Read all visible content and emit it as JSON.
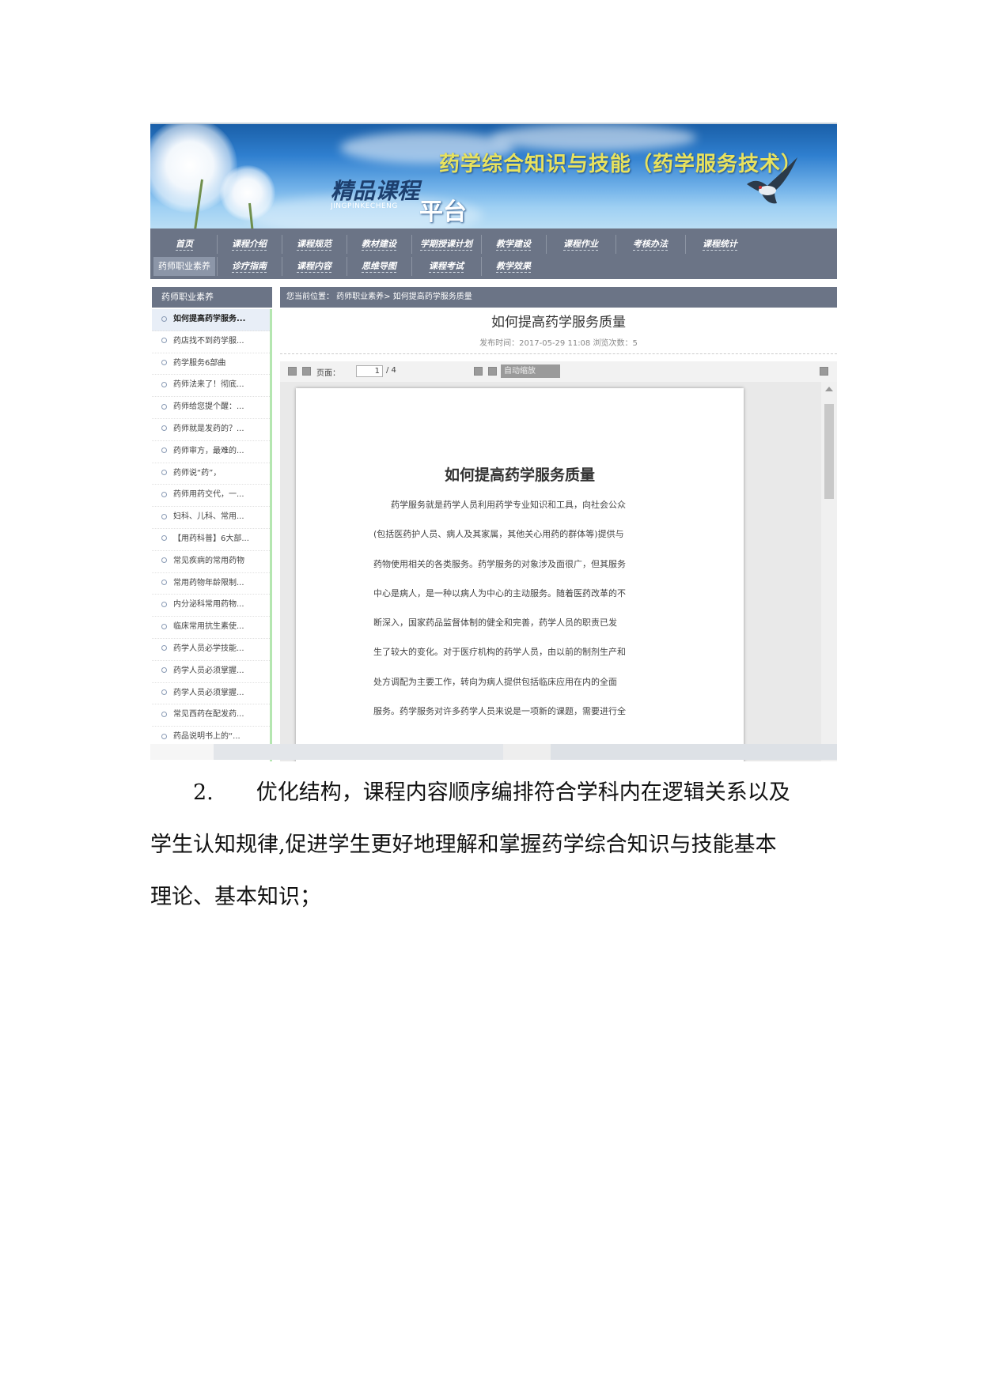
{
  "banner": {
    "course_title": "药学综合知识与技能（药学服务技术）",
    "platform_title": "精品课程",
    "platform_title2": "平台",
    "pinyin": "JINGPINKECHENG"
  },
  "nav": {
    "row1": [
      "首页",
      "课程介绍",
      "课程规范",
      "教材建设",
      "学期授课计划",
      "教学建设",
      "课程作业",
      "考核办法",
      "课程统计"
    ],
    "row2": [
      "药师职业素养",
      "诊疗指南",
      "课程内容",
      "思维导图",
      "课程考试",
      "教学效果"
    ],
    "active": "药师职业素养"
  },
  "sidebar": {
    "heading": "药师职业素养",
    "items": [
      "如何提高药学服务...",
      "药店找不到药学服...",
      "药学服务6部曲",
      "药师法来了！彻底...",
      "药师给您提个醒：...",
      "药师就是发药的？...",
      "药师审方，最难的...",
      "药师说“药”，",
      "药师用药交代，一...",
      "妇科、儿科、常用...",
      "【用药科普】6大部...",
      "常见疾病的常用药物",
      "常用药物年龄限制...",
      "内分泌科常用药物...",
      "临床常用抗生素使...",
      "药学人员必学技能...",
      "药学人员必须掌握...",
      "药学人员必须掌握...",
      "常见西药在配发药...",
      "药品说明书上的“..."
    ]
  },
  "breadcrumb": "您当前位置： 药师职业素养> 如何提高药学服务质量",
  "article": {
    "title": "如何提高药学服务质量",
    "meta": "发布时间：2017-05-29 11:08 浏览次数：5"
  },
  "pdf": {
    "page_label": "页面：",
    "page_value": "1",
    "page_total": "/ 4",
    "zoom_label": "自动缩放",
    "doc_title": "如何提高药学服务质量",
    "doc_lines": [
      "药学服务就是药学人员利用药学专业知识和工具，向社会公众",
      "(包括医药护人员、病人及其家属，其他关心用药的群体等)提供与",
      "药物使用相关的各类服务。药学服务的对象涉及面很广，但其服务",
      "中心是病人，是一种以病人为中心的主动服务。随着医药改革的不",
      "断深入，国家药品监督体制的健全和完善，药学人员的职责已发",
      "生了较大的变化。对于医疗机构的药学人员，由以前的制剂生产和",
      "处方调配为主要工作，转向为病人提供包括临床应用在内的全面",
      "服务。药学服务对许多药学人员来说是一项新的课题，需要进行全"
    ]
  },
  "paragraph": {
    "lines": [
      "2.　　优化结构，课程内容顺序编排符合学科内在逻辑关系以及",
      "学生认知规律,促进学生更好地理解和掌握药学综合知识与技能基本",
      "理论、基本知识；"
    ]
  }
}
